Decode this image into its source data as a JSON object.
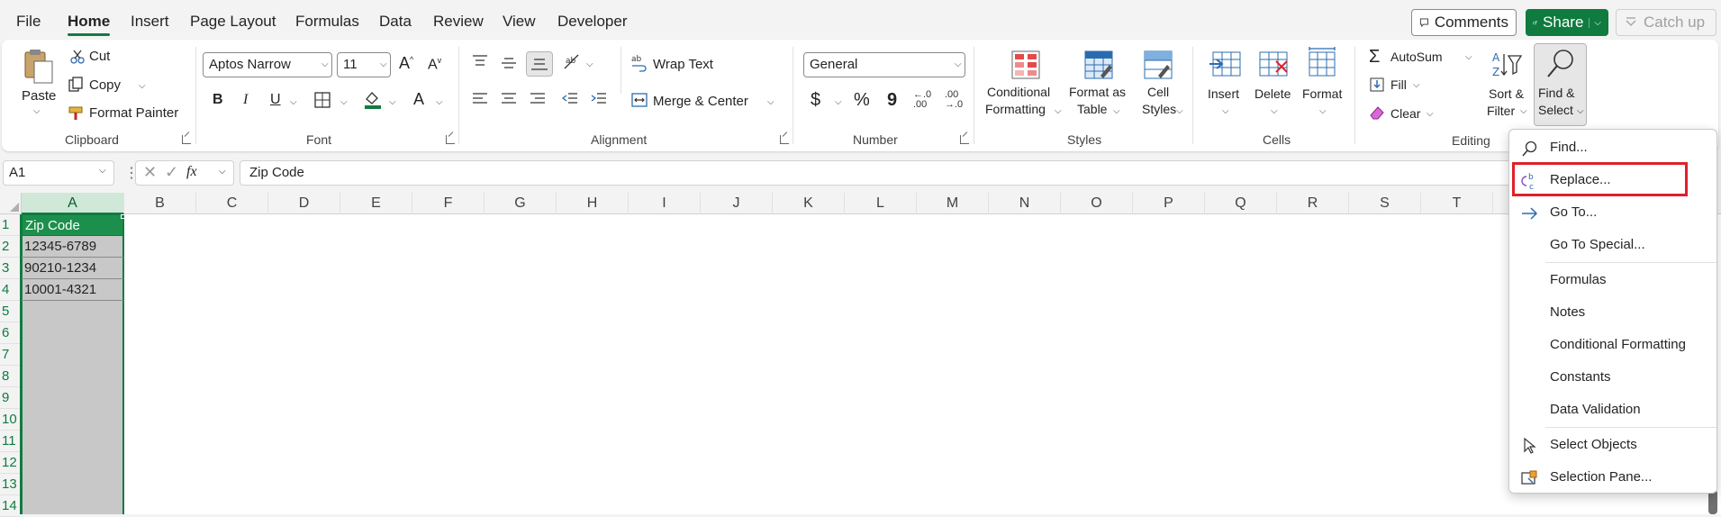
{
  "menu": {
    "tabs": [
      {
        "label": "File"
      },
      {
        "label": "Home"
      },
      {
        "label": "Insert"
      },
      {
        "label": "Page Layout"
      },
      {
        "label": "Formulas"
      },
      {
        "label": "Data"
      },
      {
        "label": "Review"
      },
      {
        "label": "View"
      },
      {
        "label": "Developer"
      }
    ],
    "active_tab": "Home",
    "comments_label": "Comments",
    "share_label": "Share",
    "catchup_label": "Catch up"
  },
  "ribbon": {
    "clipboard": {
      "paste": "Paste",
      "cut": "Cut",
      "copy": "Copy",
      "format_painter": "Format Painter",
      "group": "Clipboard"
    },
    "font": {
      "name": "Aptos Narrow",
      "size": "11",
      "bold": "B",
      "italic": "I",
      "underline": "U",
      "font_color_letter": "A",
      "grow": "A",
      "shrink": "A",
      "group": "Font"
    },
    "alignment": {
      "wrap_text": "Wrap Text",
      "merge_center": "Merge & Center",
      "group": "Alignment"
    },
    "number": {
      "format": "General",
      "currency": "$",
      "percent": "%",
      "comma": "9",
      "inc_decimal_a": "←.0",
      "inc_decimal_b": ".00",
      "dec_decimal_a": ".00",
      "dec_decimal_b": "→.0",
      "group": "Number"
    },
    "styles": {
      "cond_fmt_1": "Conditional",
      "cond_fmt_2": "Formatting",
      "fmt_table_1": "Format as",
      "fmt_table_2": "Table",
      "cell_styles_1": "Cell",
      "cell_styles_2": "Styles",
      "group": "Styles"
    },
    "cells": {
      "insert": "Insert",
      "delete": "Delete",
      "format": "Format",
      "group": "Cells"
    },
    "editing": {
      "autosum": "AutoSum",
      "fill": "Fill",
      "clear": "Clear",
      "sort_1": "Sort &",
      "sort_2": "Filter",
      "find_1": "Find &",
      "find_2": "Select",
      "group": "Editing"
    }
  },
  "formula_bar": {
    "name_box": "A1",
    "fx": "fx",
    "content": "Zip Code"
  },
  "grid": {
    "columns": [
      "A",
      "B",
      "C",
      "D",
      "E",
      "F",
      "G",
      "H",
      "I",
      "J",
      "K",
      "L",
      "M",
      "N",
      "O",
      "P",
      "Q",
      "R",
      "S",
      "T"
    ],
    "rows": [
      "1",
      "2",
      "3",
      "4",
      "5",
      "6",
      "7",
      "8",
      "9",
      "10",
      "11",
      "12",
      "13",
      "14"
    ],
    "cells": [
      "Zip Code",
      "12345-6789",
      "90210-1234",
      "10001-4321"
    ]
  },
  "find_select_menu": {
    "items": [
      {
        "label": "Find...",
        "icon": "magnifier-icon"
      },
      {
        "label": "Replace...",
        "icon": "replace-icon"
      },
      {
        "label": "Go To...",
        "icon": "arrow-right-icon"
      },
      {
        "label": "Go To Special..."
      },
      {
        "label": "Formulas"
      },
      {
        "label": "Notes"
      },
      {
        "label": "Conditional Formatting"
      },
      {
        "label": "Constants"
      },
      {
        "label": "Data Validation"
      },
      {
        "label": "Select Objects",
        "icon": "pointer-icon"
      },
      {
        "label": "Selection Pane...",
        "icon": "selection-pane-icon"
      }
    ],
    "highlight_color": "#e0202a"
  },
  "colors": {
    "accent": "#107c41",
    "share_bg": "#0f7b3f",
    "selected_header_bg": "#cfe8d8",
    "selected_column_bg": "#c8c8c8"
  }
}
